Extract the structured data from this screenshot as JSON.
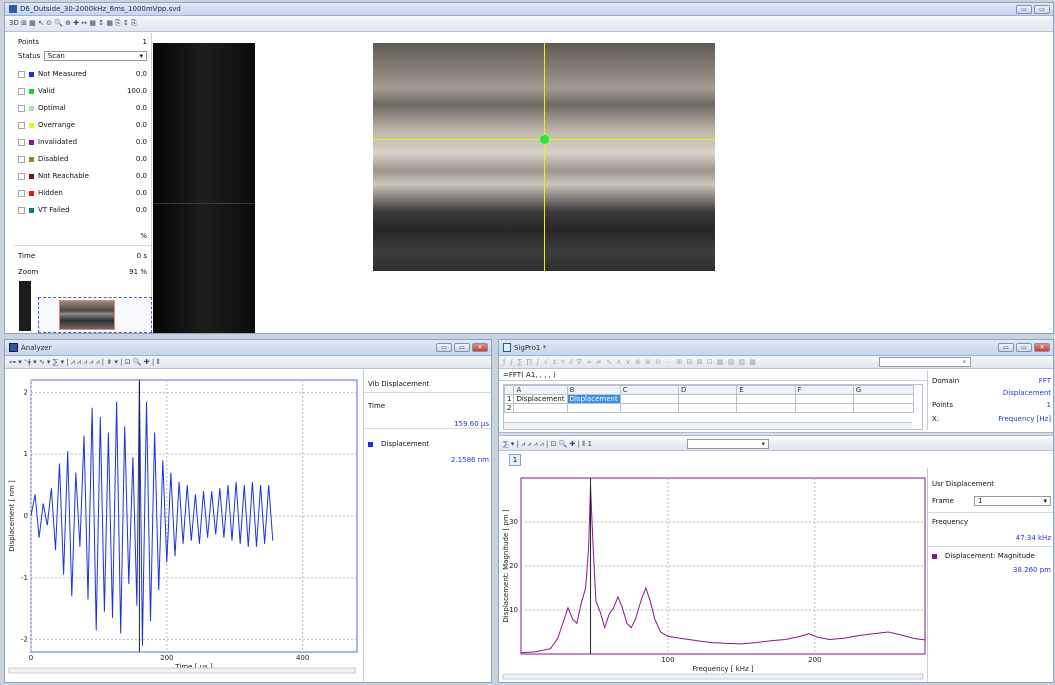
{
  "main_window": {
    "title": "D6_Outside_30-2000kHz_6ms_1000mVpp.svd",
    "toolbar_text": "3D ⊞ ▦ ↖ ⊙ 🔍 ⊕ ✚ ↔ ▦ ↕ ▦ ⎘ ↕ ⎘"
  },
  "points_panel": {
    "points_label": "Points",
    "points_value": "1",
    "status_label": "Status",
    "status_value": "Scan",
    "rows": [
      {
        "label": "Not Measured",
        "value": "0.0",
        "color": "#1a2ee8"
      },
      {
        "label": "Valid",
        "value": "100.0",
        "color": "#19d819"
      },
      {
        "label": "Optimal",
        "value": "0.0",
        "color": "#a8e6a8"
      },
      {
        "label": "Overrange",
        "value": "0.0",
        "color": "#f2f21e"
      },
      {
        "label": "Invalidated",
        "value": "0.0",
        "color": "#8b168b"
      },
      {
        "label": "Disabled",
        "value": "0.0",
        "color": "#8a8a18"
      },
      {
        "label": "Not Reachable",
        "value": "0.0",
        "color": "#7a1414"
      },
      {
        "label": "Hidden",
        "value": "0.0",
        "color": "#e61616"
      },
      {
        "label": "VT Failed",
        "value": "0.0",
        "color": "#0e7a7a"
      }
    ],
    "percent_unit": "%",
    "time_label": "Time",
    "time_value": "0 s",
    "zoom_label": "Zoom",
    "zoom_value": "91 %"
  },
  "analyzer": {
    "title": "Analyzer",
    "toolbar_text": "⊶ ▾ ⁺ǂ ▾ ∿ ▾ ⅀ ▾ | ⩘ ⩘ ⩘ ⩘ ⩘ | ⇟ ▾ | ⊡ 🔍 ✚ | ⦀",
    "side_title": "Vib Displacement",
    "side_x_label": "Time",
    "side_x_value": "159.60 µs",
    "legend_name": "Displacement",
    "legend_value": "2.1586 nm",
    "chart_data": {
      "type": "line",
      "xlabel": "Time [ µs ]",
      "ylabel": "Displacement [ nm ]",
      "xlim": [
        0,
        480
      ],
      "ylim": [
        -2.2,
        2.2
      ],
      "xticks": [
        "0",
        "200",
        "400"
      ],
      "yticks": [
        "2",
        "1",
        "0",
        "-1",
        "-2"
      ],
      "cursor_x": 159.6,
      "points": [
        [
          0,
          0
        ],
        [
          6,
          0.35
        ],
        [
          12,
          -0.35
        ],
        [
          18,
          0.2
        ],
        [
          24,
          -0.15
        ],
        [
          30,
          0.45
        ],
        [
          36,
          -0.55
        ],
        [
          42,
          0.85
        ],
        [
          48,
          -0.95
        ],
        [
          54,
          1.05
        ],
        [
          60,
          -1.3
        ],
        [
          66,
          0.7
        ],
        [
          72,
          -0.5
        ],
        [
          78,
          1.3
        ],
        [
          84,
          -1.35
        ],
        [
          90,
          1.75
        ],
        [
          96,
          -1.85
        ],
        [
          102,
          1.6
        ],
        [
          108,
          -1.55
        ],
        [
          114,
          1.35
        ],
        [
          120,
          -1.65
        ],
        [
          126,
          1.85
        ],
        [
          132,
          -1.9
        ],
        [
          138,
          1.45
        ],
        [
          144,
          -1.1
        ],
        [
          150,
          0.95
        ],
        [
          156,
          -1.45
        ],
        [
          159.6,
          2.16
        ],
        [
          164,
          -2.1
        ],
        [
          170,
          1.85
        ],
        [
          176,
          -1.7
        ],
        [
          182,
          1.35
        ],
        [
          188,
          -1.2
        ],
        [
          194,
          0.9
        ],
        [
          200,
          -0.75
        ],
        [
          206,
          0.7
        ],
        [
          212,
          -0.65
        ],
        [
          218,
          0.55
        ],
        [
          224,
          -0.45
        ],
        [
          230,
          0.5
        ],
        [
          236,
          -0.4
        ],
        [
          242,
          0.35
        ],
        [
          248,
          -0.45
        ],
        [
          254,
          0.4
        ],
        [
          260,
          -0.35
        ],
        [
          266,
          0.4
        ],
        [
          272,
          -0.3
        ],
        [
          278,
          0.45
        ],
        [
          284,
          -0.35
        ],
        [
          290,
          0.5
        ],
        [
          296,
          -0.4
        ],
        [
          302,
          0.55
        ],
        [
          308,
          -0.45
        ],
        [
          314,
          0.5
        ],
        [
          320,
          -0.5
        ],
        [
          326,
          0.55
        ],
        [
          332,
          -0.5
        ],
        [
          338,
          0.5
        ],
        [
          344,
          -0.45
        ],
        [
          350,
          0.5
        ],
        [
          356,
          -0.4
        ]
      ]
    }
  },
  "sigpro": {
    "title": "SigPro1 *",
    "formula": "=FFT( A1, , , , )",
    "col_headers": [
      "",
      "A",
      "B",
      "C",
      "D",
      "E",
      "F",
      "G"
    ],
    "row1": [
      "1",
      "Displacement",
      "Displacement",
      "",
      "",
      "",
      "",
      ""
    ],
    "row2_label": "2",
    "info": {
      "domain_label": "Domain",
      "domain_value": "FFT",
      "type_value": "Displacement",
      "points_label": "Points",
      "points_value": "1",
      "x_label": "X:",
      "x_value": "Frequency [Hz]"
    },
    "chart_toolbar_text": "⅀ ▾ | ⩘ ⩘ ⩘ ⩘ | ⊡ 🔍 ✚ | ⦀ 1",
    "tab_label": "1",
    "side_title": "Usr Displacement",
    "frame_label": "Frame",
    "frame_value": "1",
    "side_x_label": "Frequency",
    "side_x_value": "47.34 kHz",
    "legend_name": "Displacement: Magnitude",
    "legend_value": "38.260 pm",
    "chart_data": {
      "type": "line",
      "xlabel": "Frequency [ kHz ]",
      "ylabel": "Displacement: Magnitude [ pm ]",
      "xlim": [
        0,
        275
      ],
      "ylim": [
        0,
        40
      ],
      "xticks": [
        "100",
        "200"
      ],
      "yticks": [
        "30",
        "20",
        "10"
      ],
      "cursor_x": 47.34,
      "points": [
        [
          0,
          0.3
        ],
        [
          10,
          0.5
        ],
        [
          20,
          1.2
        ],
        [
          25,
          3.5
        ],
        [
          28,
          6.5
        ],
        [
          32,
          10.5
        ],
        [
          35,
          8
        ],
        [
          38,
          7
        ],
        [
          41,
          11.5
        ],
        [
          44,
          15
        ],
        [
          46,
          24
        ],
        [
          47.34,
          38.26
        ],
        [
          49,
          25
        ],
        [
          51,
          12
        ],
        [
          54,
          9.5
        ],
        [
          57,
          6
        ],
        [
          60,
          9
        ],
        [
          63,
          10.5
        ],
        [
          66,
          13
        ],
        [
          69,
          10.5
        ],
        [
          72,
          7
        ],
        [
          75,
          6
        ],
        [
          78,
          8
        ],
        [
          82,
          12.5
        ],
        [
          85,
          15
        ],
        [
          88,
          12
        ],
        [
          91,
          8
        ],
        [
          95,
          5
        ],
        [
          100,
          4
        ],
        [
          110,
          3.5
        ],
        [
          120,
          3
        ],
        [
          130,
          2.6
        ],
        [
          140,
          2.4
        ],
        [
          150,
          2.3
        ],
        [
          160,
          2.6
        ],
        [
          170,
          3
        ],
        [
          180,
          3.3
        ],
        [
          190,
          4
        ],
        [
          196,
          4.6
        ],
        [
          202,
          3.8
        ],
        [
          210,
          3.3
        ],
        [
          220,
          3.6
        ],
        [
          230,
          4.2
        ],
        [
          240,
          4.6
        ],
        [
          250,
          5
        ],
        [
          260,
          4.2
        ],
        [
          268,
          3.5
        ],
        [
          275,
          3.2
        ]
      ]
    }
  }
}
